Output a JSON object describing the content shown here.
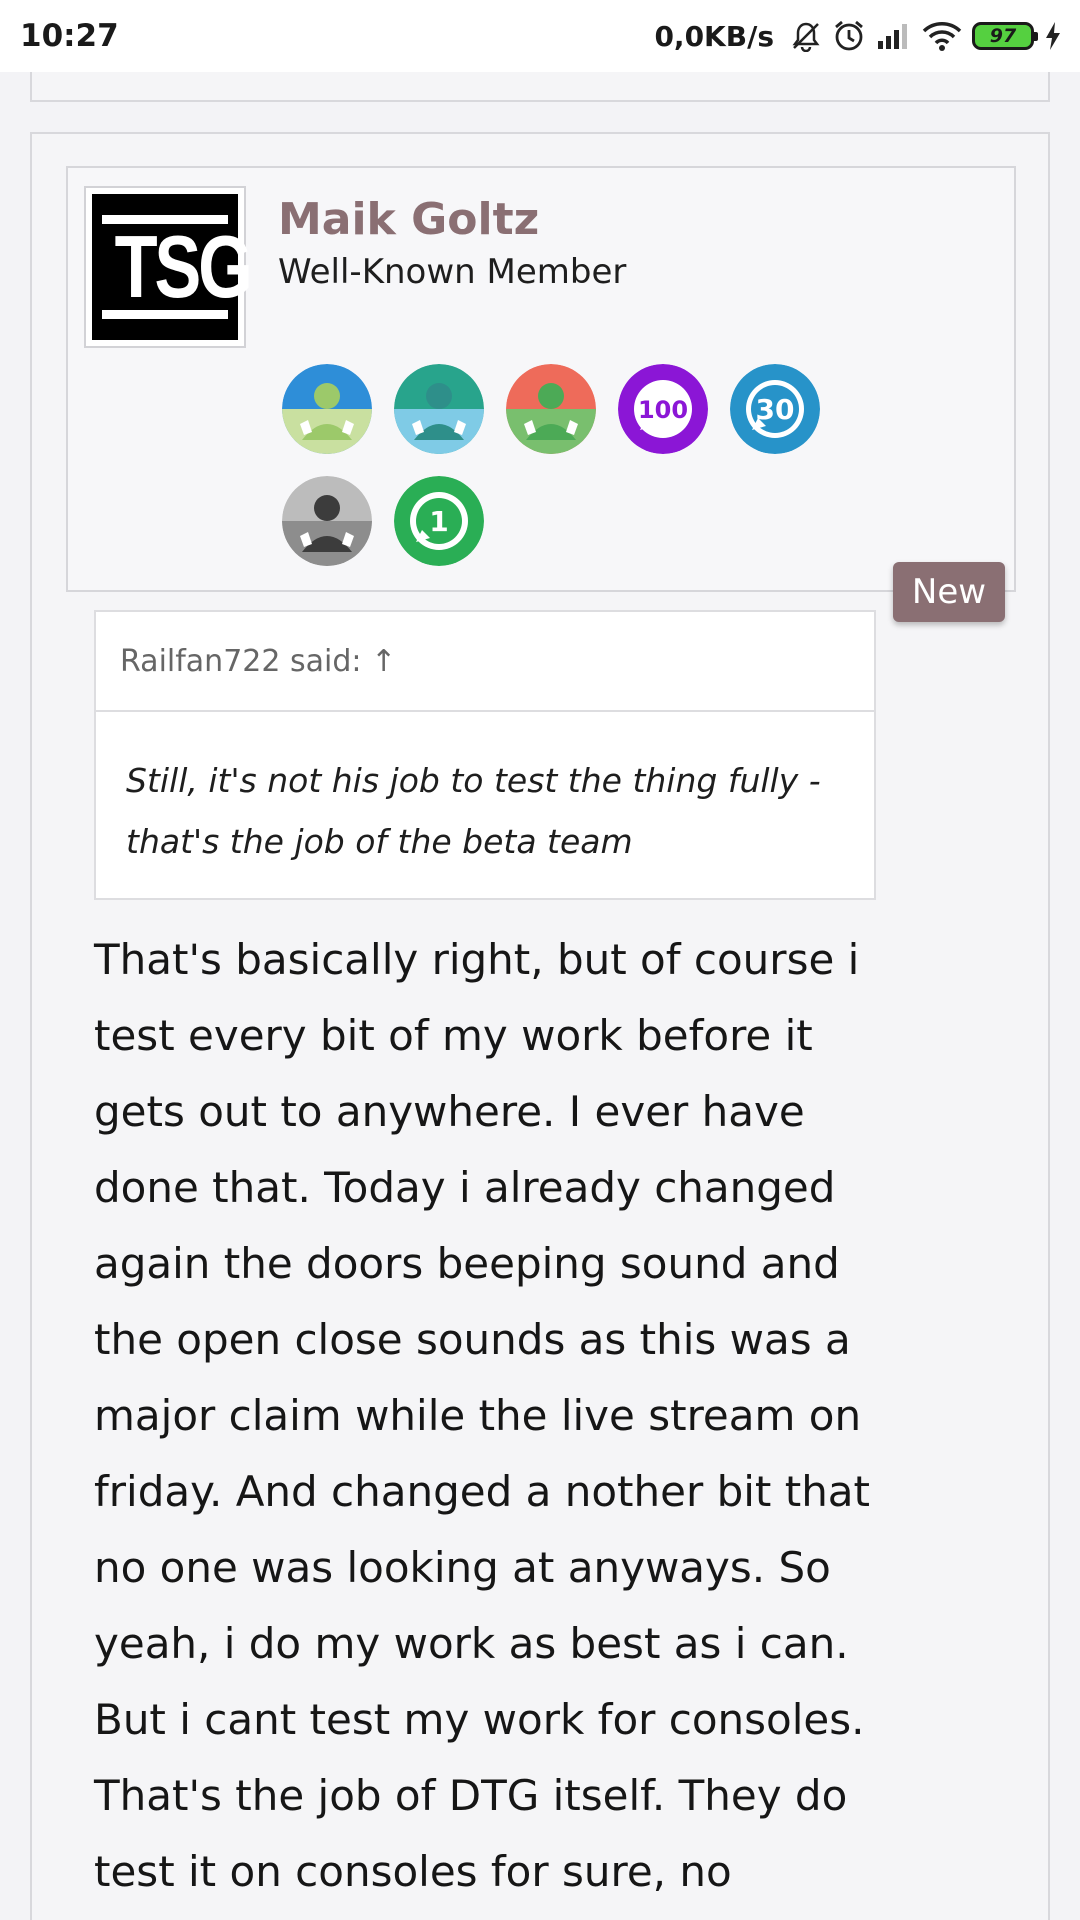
{
  "status_bar": {
    "time": "10:27",
    "network_speed": "0,0KB/s",
    "battery_level": "97",
    "icons": [
      "bell-off-icon",
      "alarm-icon",
      "signal-icon",
      "wifi-icon",
      "battery-icon",
      "charging-icon"
    ]
  },
  "post": {
    "user": {
      "name": "Maik Goltz",
      "title": "Well-Known Member",
      "avatar_text": "TSG"
    },
    "trophies": [
      {
        "name": "trophy-user-blue-icon",
        "label": ""
      },
      {
        "name": "trophy-user-teal-icon",
        "label": ""
      },
      {
        "name": "trophy-user-red-icon",
        "label": ""
      },
      {
        "name": "trophy-message-100-icon",
        "label": "100"
      },
      {
        "name": "trophy-message-30-icon",
        "label": "30"
      },
      {
        "name": "trophy-user-gray-icon",
        "label": ""
      },
      {
        "name": "trophy-message-1-icon",
        "label": "1"
      }
    ],
    "new_badge": "New",
    "quote": {
      "attribution": "Railfan722 said: ↑",
      "text": "Still, it's not his job to test the thing fully - that's the job of the beta team"
    },
    "message_lines": [
      "That's basically right, but of course i",
      "test every bit of my work before it",
      "gets out to anywhere. I ever have",
      "done that. Today i already changed",
      "again the doors beeping sound and",
      "the open close sounds as this was a",
      "major claim while the live stream on",
      "friday. And changed a nother bit that",
      "no one was looking at anyways. So",
      "yeah, i do my work as best as i can.",
      "But i cant test my work for consoles.",
      "That's the job of DTG itself. They do",
      "test it on consoles for sure, no"
    ]
  },
  "colors": {
    "accent": "#8a6f73",
    "background": "#f3f3f6",
    "battery_fill": "#55d040"
  }
}
